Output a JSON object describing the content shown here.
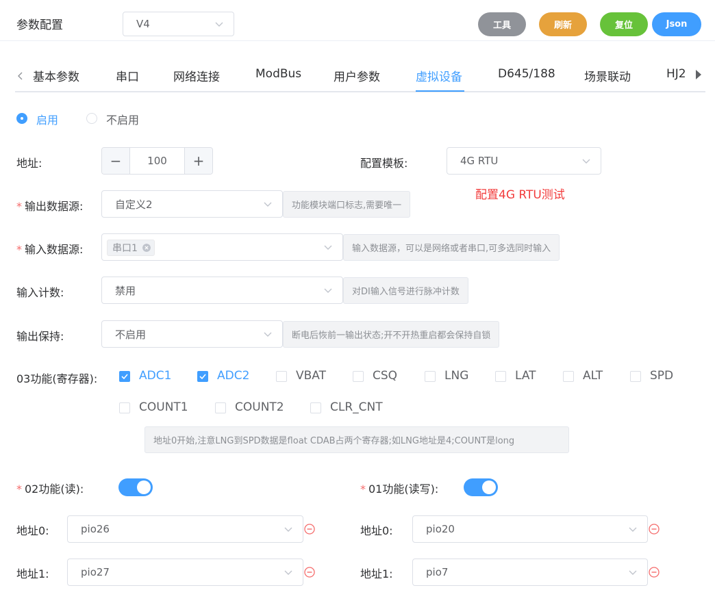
{
  "header": {
    "title": "参数配置",
    "version_select": "V4",
    "buttons": {
      "tools": "工具",
      "refresh": "刷新",
      "reset": "复位",
      "json": "Json"
    },
    "colors": {
      "tools": "#909399",
      "refresh": "#e6a23c",
      "reset": "#67c23a",
      "json": "#409eff"
    }
  },
  "tabs": [
    "基本参数",
    "串口",
    "网络连接",
    "ModBus",
    "用户参数",
    "虚拟设备",
    "D645/188",
    "场景联动",
    "HJ2"
  ],
  "active_tab": "虚拟设备",
  "enable_radio": {
    "on_label": "启用",
    "off_label": "不启用",
    "selected": "启用"
  },
  "form": {
    "address_label": "地址:",
    "address_value": "100",
    "template_label": "配置模板:",
    "template_value": "4G RTU",
    "template_note": "配置4G RTU测试",
    "output_source_label": "输出数据源:",
    "output_source_value": "自定义2",
    "output_source_hint": "功能模块端口标志,需要唯一",
    "input_source_label": "输入数据源:",
    "input_source_tag": "串口1",
    "input_source_hint": "输入数据源，可以是网络或者串口,可多选同时输入",
    "input_count_label": "输入计数:",
    "input_count_value": "禁用",
    "input_count_hint": "对DI输入信号进行脉冲计数",
    "output_hold_label": "输出保持:",
    "output_hold_value": "不启用",
    "output_hold_hint": "断电后恢前一输出状态;开不开热重启都会保持自锁"
  },
  "func03": {
    "label": "03功能(寄存器):",
    "items": [
      {
        "label": "ADC1",
        "checked": true
      },
      {
        "label": "ADC2",
        "checked": true
      },
      {
        "label": "VBAT",
        "checked": false
      },
      {
        "label": "CSQ",
        "checked": false
      },
      {
        "label": "LNG",
        "checked": false
      },
      {
        "label": "LAT",
        "checked": false
      },
      {
        "label": "ALT",
        "checked": false
      },
      {
        "label": "SPD",
        "checked": false
      },
      {
        "label": "COUNT1",
        "checked": false
      },
      {
        "label": "COUNT2",
        "checked": false
      },
      {
        "label": "CLR_CNT",
        "checked": false
      }
    ],
    "hint": "地址0开始,注意LNG到SPD数据是float CDAB占两个寄存器;如LNG地址是4;COUNT是long"
  },
  "func02": {
    "label": "02功能(读):",
    "enabled": true,
    "addr0_label": "地址0:",
    "addr0_value": "pio26",
    "addr1_label": "地址1:",
    "addr1_value": "pio27"
  },
  "func01": {
    "label": "01功能(读写):",
    "enabled": true,
    "addr0_label": "地址0:",
    "addr0_value": "pio20",
    "addr1_label": "地址1:",
    "addr1_value": "pio7"
  }
}
